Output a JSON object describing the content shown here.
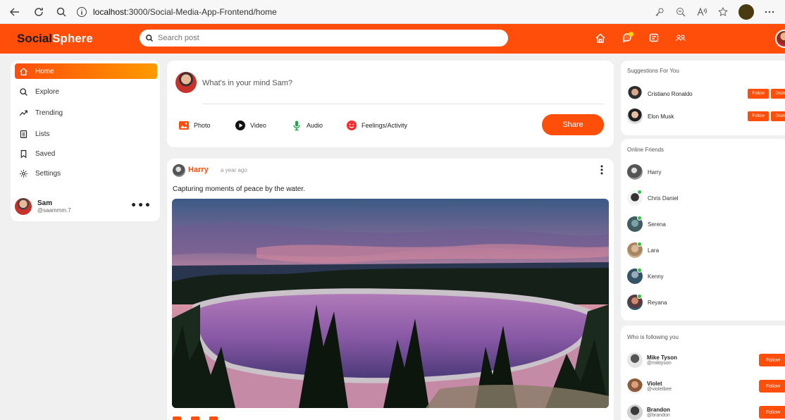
{
  "browser": {
    "url_host": "localhost",
    "url_rest": ":3000/Social-Media-App-Frontend/home"
  },
  "app": {
    "logo_part1": "Social",
    "logo_part2": "Sphere",
    "search_placeholder": "Search post"
  },
  "colors": {
    "brand": "#ff4d0a",
    "accent_gradient_end": "#ff9a00",
    "online": "#2ec23d"
  },
  "sidebar": {
    "items": [
      {
        "label": "Home",
        "icon": "home-icon",
        "active": true
      },
      {
        "label": "Explore",
        "icon": "search-icon"
      },
      {
        "label": "Trending",
        "icon": "trending-icon"
      },
      {
        "label": "Lists",
        "icon": "list-icon"
      },
      {
        "label": "Saved",
        "icon": "bookmark-icon"
      },
      {
        "label": "Settings",
        "icon": "gear-icon"
      }
    ],
    "user": {
      "name": "Sam",
      "handle": "@saammm.7"
    }
  },
  "composer": {
    "prompt": "What's in your mind Sam?",
    "actions": [
      {
        "label": "Photo"
      },
      {
        "label": "Video"
      },
      {
        "label": "Audio"
      },
      {
        "label": "Feelings/Activity"
      }
    ],
    "share_label": "Share"
  },
  "post": {
    "author": "Harry",
    "time": "a year ago",
    "caption": "Capturing moments of peace by the water."
  },
  "suggestions": {
    "title": "Suggestions For You",
    "users": [
      {
        "name": "Cristiano Ronaldo",
        "follow": "Follow",
        "dismiss": "Dism"
      },
      {
        "name": "Elon Musk",
        "follow": "Follow",
        "dismiss": "Dism"
      }
    ]
  },
  "online": {
    "title": "Online Friends",
    "friends": [
      "Harry",
      "Chris Daniel",
      "Serena",
      "Lara",
      "Kenny",
      "Reyana"
    ]
  },
  "followers": {
    "title": "Who is following you",
    "users": [
      {
        "name": "Mike Tyson",
        "handle": "@miktyson",
        "button": "Follow"
      },
      {
        "name": "Violet",
        "handle": "@violetbee",
        "button": "Follow"
      },
      {
        "name": "Brandon",
        "handle": "@brandon",
        "button": "Follow"
      }
    ]
  }
}
